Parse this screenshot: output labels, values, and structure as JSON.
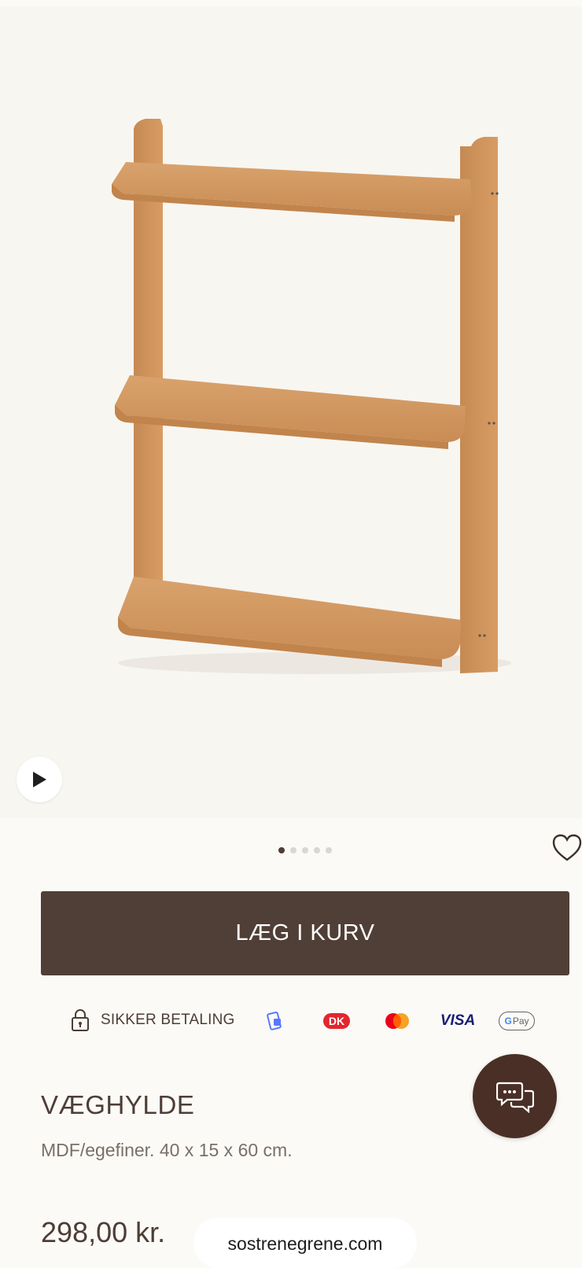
{
  "product": {
    "image_icon": "wall-shelf-photo",
    "play_icon": "play-icon",
    "gallery_total": 5,
    "gallery_active_index": 1,
    "title": "VÆGHYLDE",
    "description": "MDF/egefiner. 40 x 15 x 60 cm.",
    "price": "298,00 kr."
  },
  "actions": {
    "add_to_cart_label": "LÆG I KURV",
    "favorite_icon": "heart-icon"
  },
  "payment": {
    "secure_label": "SIKKER BETALING",
    "visa_label": "VISA",
    "gpay_label": "Pay",
    "methods": [
      "mobilepay",
      "dankort",
      "mastercard",
      "visa",
      "google-pay"
    ]
  },
  "chat": {
    "icon": "chat-bubbles-icon"
  },
  "browser": {
    "url": "sostrenegrene.com"
  },
  "colors": {
    "primary_button": "#503f36",
    "text": "#4d3d36",
    "chat_button": "#4a2f26",
    "background": "#fbfaf6"
  }
}
